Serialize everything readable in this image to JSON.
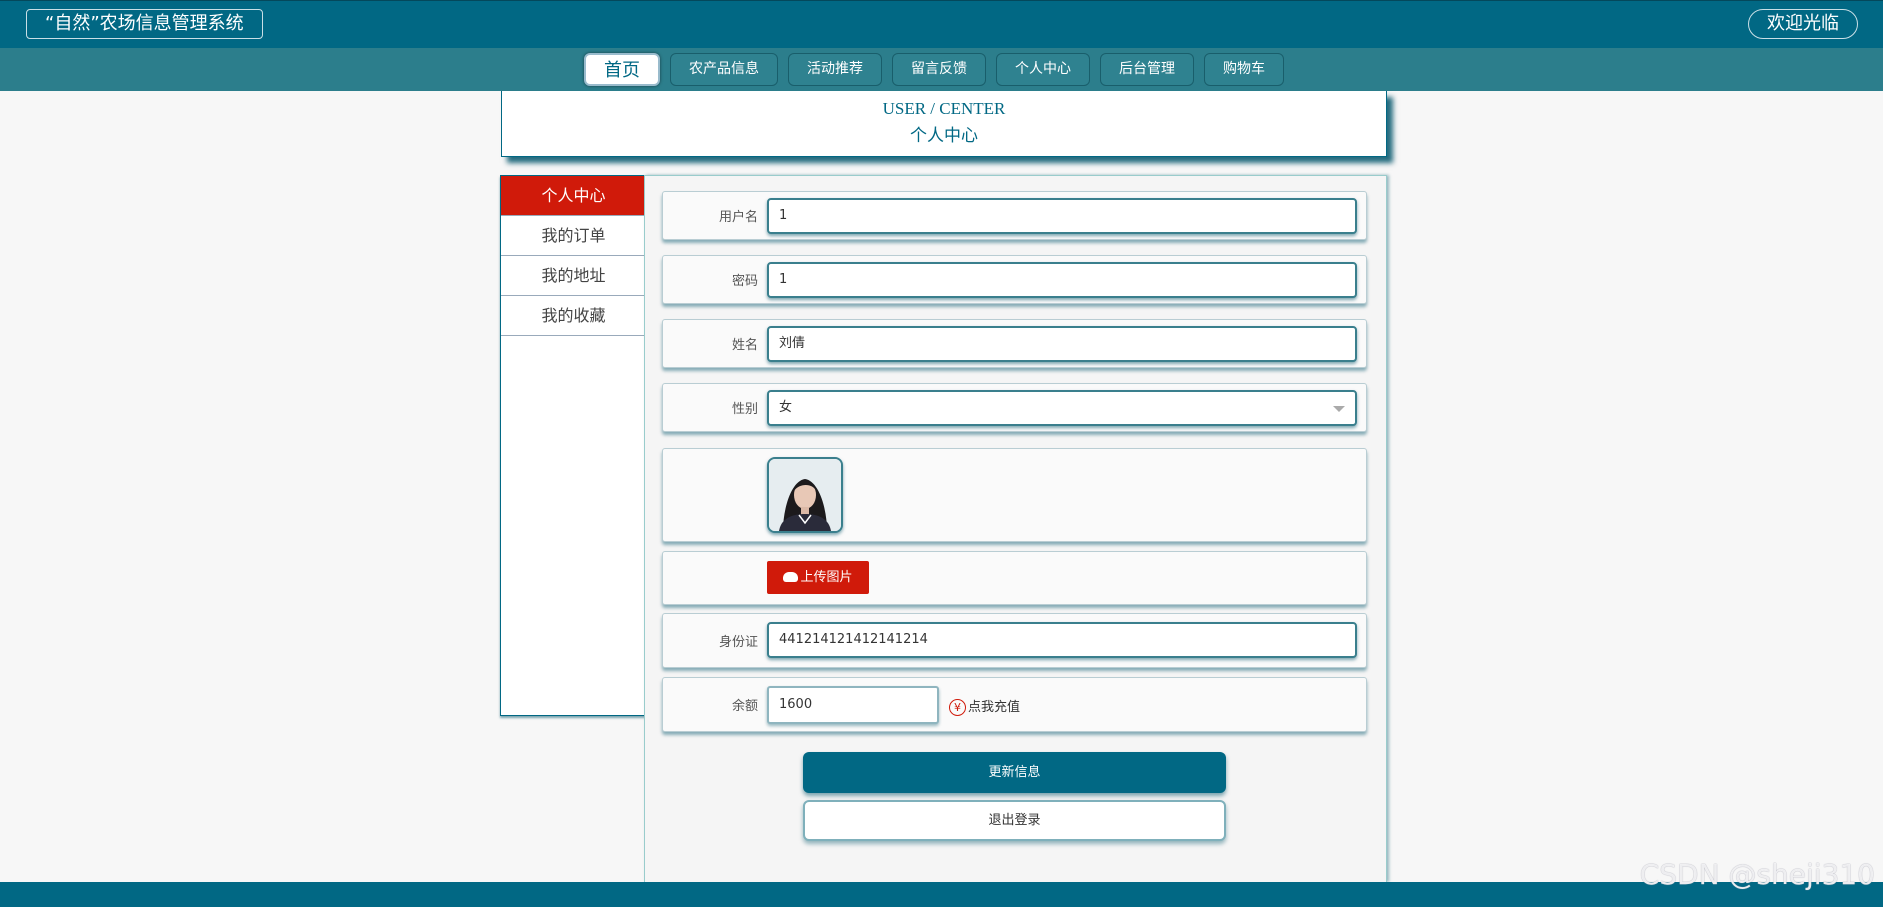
{
  "header": {
    "brand": "“自然”农场信息管理系统",
    "welcome": "欢迎光临"
  },
  "nav": {
    "items": [
      "首页",
      "农产品信息",
      "活动推荐",
      "留言反馈",
      "个人中心",
      "后台管理",
      "购物车"
    ]
  },
  "page_header": {
    "title_en": "USER / CENTER",
    "title_cn": "个人中心"
  },
  "sidebar": {
    "items": [
      "个人中心",
      "我的订单",
      "我的地址",
      "我的收藏"
    ]
  },
  "form": {
    "username_label": "用户名",
    "username_value": "1",
    "password_label": "密码",
    "password_value": "1",
    "name_label": "姓名",
    "name_value": "刘倩",
    "gender_label": "性别",
    "gender_value": "女",
    "upload_label": "上传图片",
    "id_label": "身份证",
    "id_value": "441214121412141214",
    "balance_label": "余额",
    "balance_value": "1600",
    "recharge_label": "点我充值",
    "recharge_icon": "¥"
  },
  "actions": {
    "update_label": "更新信息",
    "logout_label": "退出登录"
  },
  "watermark": "CSDN @sheji310",
  "colors": {
    "primary": "#016884",
    "nav_bar": "#2c7e8c",
    "accent_red": "#d01a0a"
  }
}
